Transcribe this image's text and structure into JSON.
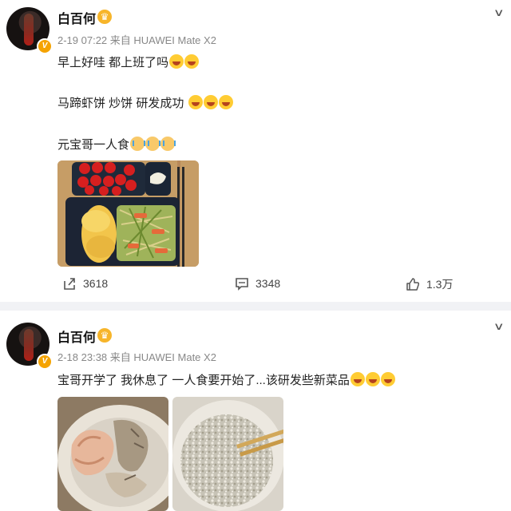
{
  "posts": [
    {
      "username": "白百何",
      "meta": "2-19 07:22 来自 HUAWEI Mate X2",
      "lines": [
        "早上好哇 都上班了吗",
        "马蹄虾饼 炒饼 研发成功",
        "元宝哥一人食"
      ],
      "line_emojis": [
        [
          "laugh-emoji",
          "laugh-emoji"
        ],
        [
          "laugh-emoji",
          "laugh-emoji",
          "laugh-emoji"
        ],
        [
          "cry-emoji",
          "cry-emoji",
          "cry-emoji"
        ]
      ],
      "shares": "3618",
      "comments": "3348",
      "likes": "1.3万"
    },
    {
      "username": "白百何",
      "meta": "2-18 23:38 来自 HUAWEI Mate X2",
      "lines": [
        "宝哥开学了 我休息了 一人食要开始了...该研发些新菜品"
      ],
      "line_emojis": [
        [
          "laugh-emoji",
          "laugh-emoji",
          "laugh-emoji"
        ]
      ]
    }
  ],
  "icons": [
    "chevron-down-icon",
    "share-icon",
    "comment-icon",
    "like-icon",
    "verified-badge-icon",
    "vip-icon"
  ],
  "colors": {
    "verified": "#f5a300",
    "meta_text": "#888888",
    "divider": "#f1f2f5"
  }
}
